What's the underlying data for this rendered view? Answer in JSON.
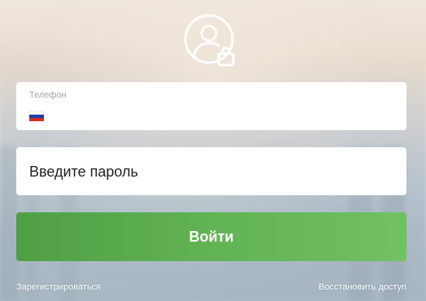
{
  "avatar": {
    "icon": "user-lock-icon"
  },
  "phone": {
    "label": "Телефон",
    "value": "",
    "country_flag": "russia-flag-icon"
  },
  "password": {
    "placeholder": "Введите пароль",
    "value": ""
  },
  "login_button": {
    "label": "Войти"
  },
  "links": {
    "register": "Зарегистрироваться",
    "restore": "Восстановить доступ"
  },
  "colors": {
    "button_start": "#4f9e45",
    "button_end": "#71c062",
    "field_bg": "#ffffff",
    "label_gray": "#a6a6a6"
  }
}
